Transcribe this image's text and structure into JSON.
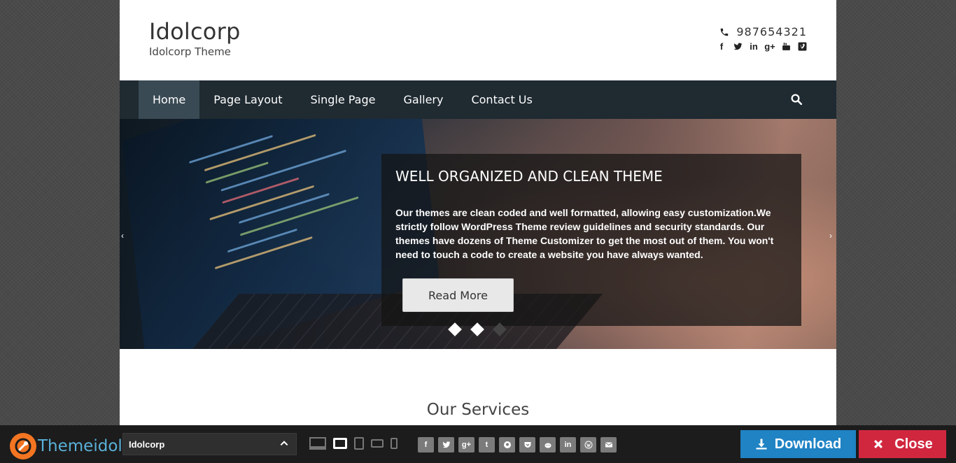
{
  "header": {
    "site_title": "Idolcorp",
    "tagline": "Idolcorp Theme",
    "phone": "987654321",
    "social_icons": [
      "facebook-icon",
      "twitter-icon",
      "linkedin-icon",
      "google-plus-icon",
      "youtube-icon",
      "vimeo-icon"
    ]
  },
  "nav": {
    "items": [
      {
        "label": "Home",
        "active": true
      },
      {
        "label": "Page Layout"
      },
      {
        "label": "Single Page"
      },
      {
        "label": "Gallery"
      },
      {
        "label": "Contact Us"
      }
    ]
  },
  "slider": {
    "title": "WELL ORGANIZED AND CLEAN THEME",
    "text": "Our themes are clean coded and well formatted, allowing easy customization.We strictly follow WordPress Theme review guidelines and security standards. Our themes have dozens of Theme Customizer to get the most out of them. You won't need to touch a code to create a website you have always wanted.",
    "button_label": "Read More",
    "slides_total": 3
  },
  "services": {
    "title": "Our Services"
  },
  "bottom_bar": {
    "brand": "Themeidol",
    "theme_select_value": "Idolcorp",
    "devices": [
      "desktop-icon",
      "laptop-icon",
      "tablet-icon",
      "tablet-landscape-icon",
      "phone-icon"
    ],
    "share_icons": [
      "facebook-icon",
      "twitter-icon",
      "google-plus-icon",
      "tumblr-icon",
      "pinterest-icon",
      "pocket-icon",
      "reddit-icon",
      "linkedin-icon",
      "wordpress-icon",
      "email-icon"
    ],
    "download_label": "Download",
    "close_label": "Close",
    "colors": {
      "download": "#1f83c4",
      "close": "#d0273f",
      "brand_orange": "#f47521"
    }
  }
}
